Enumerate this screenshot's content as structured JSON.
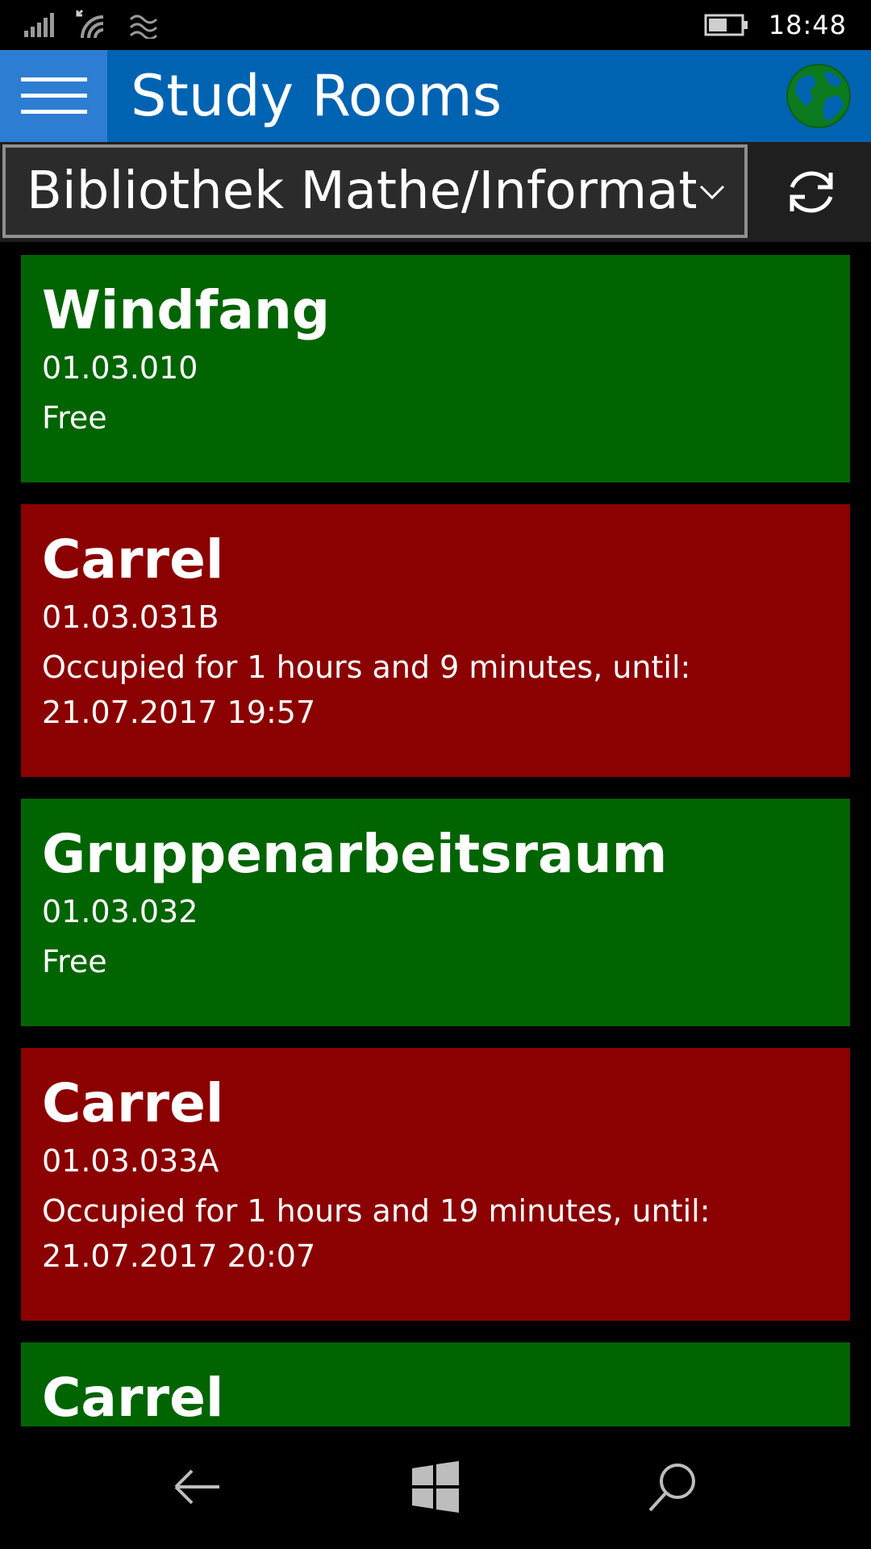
{
  "status_bar": {
    "time": "18:48",
    "icons": [
      "signal-icon",
      "wifi-icon",
      "cellular-data-icon",
      "battery-icon"
    ]
  },
  "app_bar": {
    "title": "Study Rooms",
    "menu_icon": "hamburger-menu-icon",
    "globe_icon": "globe-icon"
  },
  "selector": {
    "value": "Bibliothek Mathe/Informatik",
    "refresh_icon": "refresh-icon"
  },
  "colors": {
    "appbar": "#0063B1",
    "free": "#006400",
    "occupied": "#8B0000"
  },
  "rooms": [
    {
      "name": "Windfang",
      "code": "01.03.010",
      "status": "Free",
      "state": "free"
    },
    {
      "name": "Carrel",
      "code": "01.03.031B",
      "status": "Occupied for 1 hours and 9 minutes, until: 21.07.2017 19:57",
      "state": "occupied"
    },
    {
      "name": "Gruppenarbeitsraum",
      "code": "01.03.032",
      "status": "Free",
      "state": "free"
    },
    {
      "name": "Carrel",
      "code": "01.03.033A",
      "status": "Occupied for 1 hours and 19 minutes, until: 21.07.2017 20:07",
      "state": "occupied"
    },
    {
      "name": "Carrel",
      "code": "",
      "status": "",
      "state": "free"
    }
  ],
  "nav_bar": {
    "back_icon": "back-arrow-icon",
    "home_icon": "windows-start-icon",
    "search_icon": "search-icon"
  }
}
